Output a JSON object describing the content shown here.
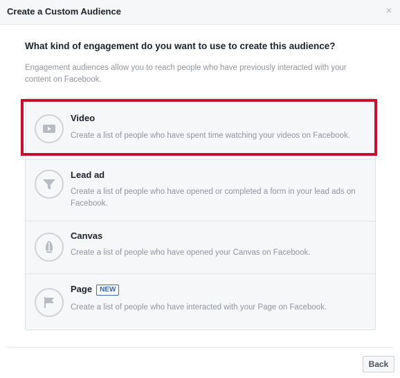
{
  "dialog": {
    "title": "Create a Custom Audience",
    "close_glyph": "×"
  },
  "main": {
    "question": "What kind of engagement do you want to use to create this audience?",
    "description": "Engagement audiences allow you to reach people who have previously interacted with your content on Facebook."
  },
  "options": [
    {
      "icon": "video-play-icon",
      "title": "Video",
      "description": "Create a list of people who have spent time watching your videos on Facebook."
    },
    {
      "icon": "funnel-icon",
      "title": "Lead ad",
      "description": "Create a list of people who have opened or completed a form in your lead ads on Facebook."
    },
    {
      "icon": "canvas-icon",
      "title": "Canvas",
      "description": "Create a list of people who have opened your Canvas on Facebook."
    },
    {
      "icon": "flag-icon",
      "title": "Page",
      "badge": "NEW",
      "description": "Create a list of people who have interacted with your Page on Facebook."
    }
  ],
  "footer": {
    "back_label": "Back"
  },
  "colors": {
    "highlight": "#c8102e",
    "badge": "#4267b2",
    "icon_stroke": "#cfd2d6",
    "icon_fill": "#b8bcc2"
  }
}
